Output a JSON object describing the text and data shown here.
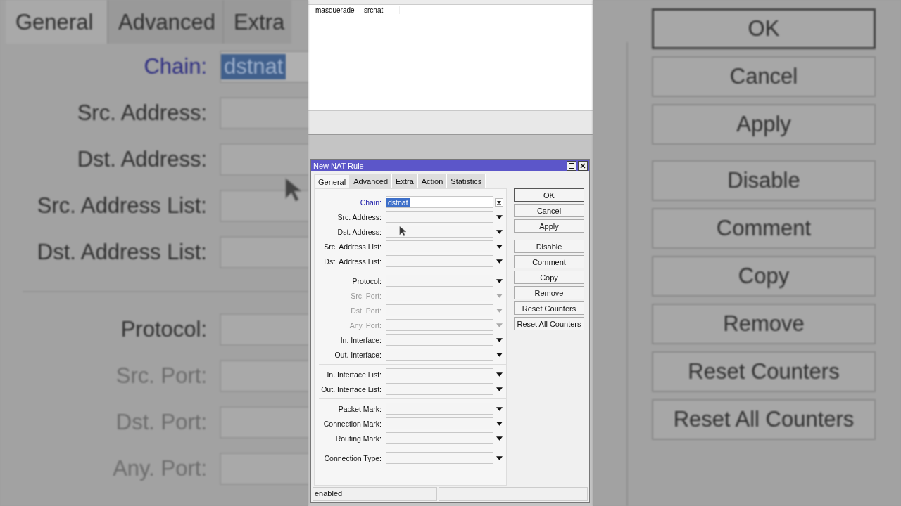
{
  "backdrop_left": {
    "tabs": [
      {
        "label": "General",
        "selected": true
      },
      {
        "label": "Advanced",
        "selected": false
      },
      {
        "label": "Extra",
        "selected": false
      }
    ],
    "groups": [
      [
        {
          "label": "Chain:",
          "kind": "combo",
          "value": "dstnat",
          "disabled": false
        },
        {
          "label": "Src. Address:",
          "kind": "dropdown",
          "disabled": false
        },
        {
          "label": "Dst. Address:",
          "kind": "dropdown",
          "disabled": false
        },
        {
          "label": "Src. Address List:",
          "kind": "dropdown",
          "disabled": false
        },
        {
          "label": "Dst. Address List:",
          "kind": "dropdown",
          "disabled": false
        }
      ],
      [
        {
          "label": "Protocol:",
          "kind": "dropdown",
          "disabled": false
        },
        {
          "label": "Src. Port:",
          "kind": "dropdown",
          "disabled": true
        },
        {
          "label": "Dst. Port:",
          "kind": "dropdown",
          "disabled": true
        },
        {
          "label": "Any. Port:",
          "kind": "dropdown",
          "disabled": true
        }
      ]
    ]
  },
  "rule_list": {
    "rows": [
      {
        "cells": [
          "masquerade",
          "srcnat"
        ]
      }
    ]
  },
  "dialog": {
    "title": "New NAT Rule",
    "tabs": [
      {
        "label": "General",
        "selected": true
      },
      {
        "label": "Advanced",
        "selected": false
      },
      {
        "label": "Extra",
        "selected": false
      },
      {
        "label": "Action",
        "selected": false
      },
      {
        "label": "Statistics",
        "selected": false
      }
    ],
    "groups": [
      [
        {
          "label": "Chain:",
          "kind": "combo",
          "value": "dstnat",
          "disabled": false
        },
        {
          "label": "Src. Address:",
          "kind": "dropdown",
          "disabled": false
        },
        {
          "label": "Dst. Address:",
          "kind": "dropdown",
          "disabled": false
        },
        {
          "label": "Src. Address List:",
          "kind": "dropdown",
          "disabled": false
        },
        {
          "label": "Dst. Address List:",
          "kind": "dropdown",
          "disabled": false
        }
      ],
      [
        {
          "label": "Protocol:",
          "kind": "dropdown",
          "disabled": false
        },
        {
          "label": "Src. Port:",
          "kind": "dropdown",
          "disabled": true
        },
        {
          "label": "Dst. Port:",
          "kind": "dropdown",
          "disabled": true
        },
        {
          "label": "Any. Port:",
          "kind": "dropdown",
          "disabled": true
        },
        {
          "label": "In. Interface:",
          "kind": "dropdown",
          "disabled": false
        },
        {
          "label": "Out. Interface:",
          "kind": "dropdown",
          "disabled": false
        }
      ],
      [
        {
          "label": "In. Interface List:",
          "kind": "dropdown",
          "disabled": false
        },
        {
          "label": "Out. Interface List:",
          "kind": "dropdown",
          "disabled": false
        }
      ],
      [
        {
          "label": "Packet Mark:",
          "kind": "dropdown",
          "disabled": false
        },
        {
          "label": "Connection Mark:",
          "kind": "dropdown",
          "disabled": false
        },
        {
          "label": "Routing Mark:",
          "kind": "dropdown",
          "disabled": false
        }
      ],
      [
        {
          "label": "Connection Type:",
          "kind": "dropdown",
          "disabled": false
        }
      ]
    ],
    "button_groups": [
      [
        "OK",
        "Cancel",
        "Apply"
      ],
      [
        "Disable",
        "Comment",
        "Copy",
        "Remove",
        "Reset Counters",
        "Reset All Counters"
      ]
    ],
    "status": "enabled"
  },
  "backdrop_right": {
    "button_groups": [
      [
        "OK",
        "Cancel",
        "Apply"
      ],
      [
        "Disable",
        "Comment",
        "Copy",
        "Remove",
        "Reset Counters",
        "Reset All Counters"
      ]
    ]
  }
}
